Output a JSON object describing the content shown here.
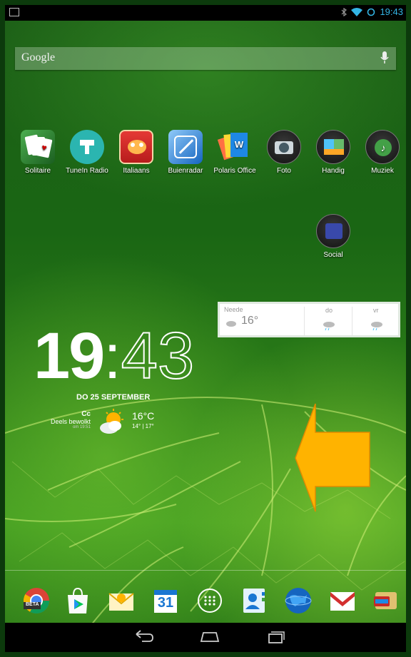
{
  "status_bar": {
    "time": "19:43",
    "icons": [
      "image-icon",
      "bluetooth-icon",
      "wifi-icon",
      "sync-icon"
    ]
  },
  "search": {
    "label": "Google",
    "icon": "mic-icon"
  },
  "apps": [
    {
      "label": "Solitaire",
      "icon": "solitaire-icon"
    },
    {
      "label": "TuneIn Radio",
      "icon": "tunein-icon"
    },
    {
      "label": "Italiaans",
      "icon": "italiaans-icon"
    },
    {
      "label": "Buienradar",
      "icon": "buienradar-icon"
    },
    {
      "label": "Polaris Office",
      "icon": "polaris-office-icon"
    },
    {
      "label": "Foto",
      "icon": "camera-icon"
    },
    {
      "label": "Handig",
      "icon": "folder-icon"
    },
    {
      "label": "Muziek",
      "icon": "music-icon"
    }
  ],
  "social": {
    "label": "Social",
    "icon": "folder-icon"
  },
  "clock": {
    "hour": "19",
    "minute": "43",
    "separator": ":"
  },
  "date": "DO 25 SEPTEMBER",
  "weather_clock": {
    "location": "Cc",
    "condition": "Deels bewolkt",
    "updated": "om 19:51",
    "temp": "16°C",
    "minmax": "14° | 17°"
  },
  "weather_widget": {
    "location": "Neede",
    "temp": "16°",
    "day1": "do",
    "day2": "vr"
  },
  "dock": [
    "chrome-beta-icon",
    "play-store-icon",
    "email-icon",
    "calendar-icon",
    "app-drawer-icon",
    "contacts-icon",
    "browser-globe-icon",
    "gmail-icon",
    "wallet-icon"
  ],
  "dock_labels": {
    "chrome_badge": "BETA",
    "calendar_day": "31"
  },
  "nav": [
    "back-icon",
    "home-icon",
    "recent-apps-icon"
  ],
  "colors": {
    "status_accent": "#33b5e5",
    "arrow": "#ffb300"
  }
}
